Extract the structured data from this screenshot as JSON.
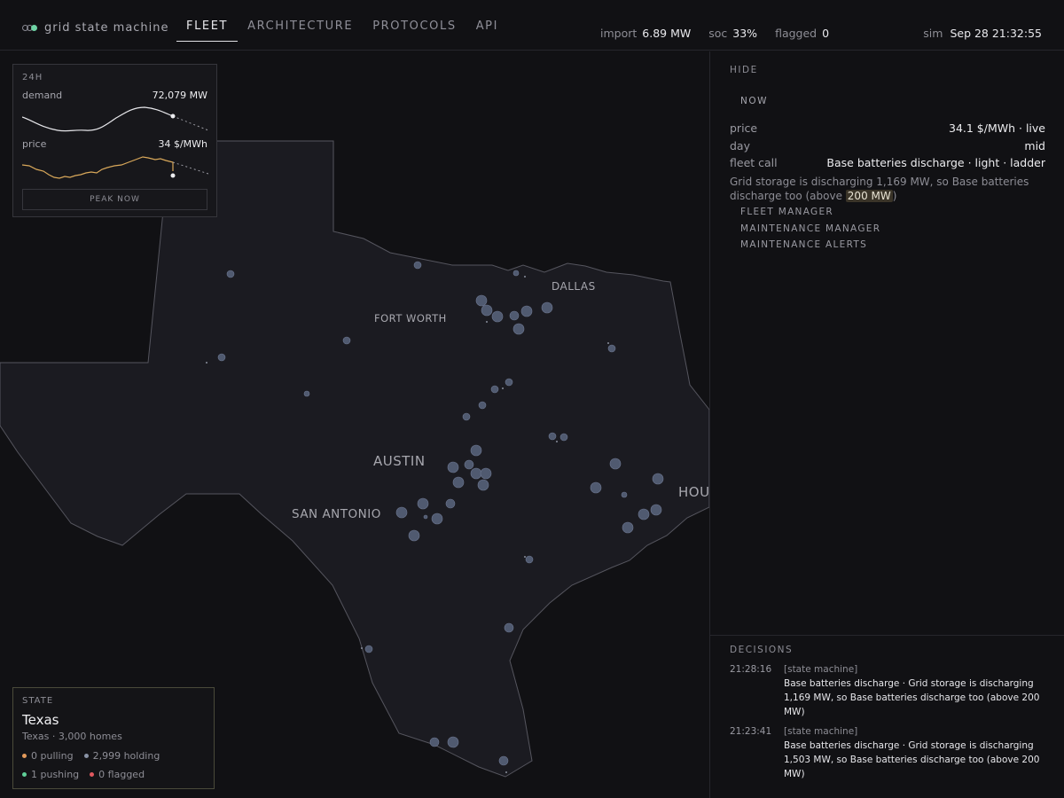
{
  "app": {
    "title": "grid state machine"
  },
  "nav": {
    "tabs": [
      {
        "label": "FLEET",
        "active": true
      },
      {
        "label": "ARCHITECTURE",
        "active": false
      },
      {
        "label": "PROTOCOLS",
        "active": false
      },
      {
        "label": "API",
        "active": false
      }
    ]
  },
  "stats": {
    "import": {
      "label": "import",
      "value": "6.89 MW"
    },
    "soc": {
      "label": "soc",
      "value": "33%"
    },
    "flagged": {
      "label": "flagged",
      "value": "0"
    }
  },
  "sim": {
    "label": "sim",
    "value": "Sep 28 21:32:55"
  },
  "map": {
    "cities": [
      "DALLAS",
      "FORT WORTH",
      "AUSTIN",
      "SAN ANTONIO",
      "HOU"
    ]
  },
  "mini_panel": {
    "header": "24H",
    "demand": {
      "label": "demand",
      "value": "72,079 MW"
    },
    "price": {
      "label": "price",
      "value": "34 $/MWh"
    },
    "button": "PEAK NOW",
    "colors": {
      "demand": "#e6e6ea",
      "price": "#d9a85a"
    }
  },
  "state_card": {
    "header": "STATE",
    "title": "Texas",
    "subtitle": "Texas · 3,000 homes",
    "counts": [
      {
        "label": "0 pulling",
        "color": "#e39a5b"
      },
      {
        "label": "2,999 holding",
        "color": "#8a93a6"
      },
      {
        "label": "1 pushing",
        "color": "#5fcf98"
      },
      {
        "label": "0 flagged",
        "color": "#e0585f"
      }
    ]
  },
  "panel": {
    "hide_label": "HIDE",
    "now_label": "NOW",
    "rows": [
      {
        "key": "price",
        "value": "34.1 $/MWh · live"
      },
      {
        "key": "day",
        "value": "mid"
      },
      {
        "key": "fleet call",
        "value": "Base batteries discharge · light · ladder"
      }
    ],
    "explanation": {
      "before": "Grid storage is discharging 1,169 MW, so Base batteries discharge too (above ",
      "highlight": "200 MW",
      "after": ")"
    },
    "links": [
      "FLEET MANAGER",
      "MAINTENANCE MANAGER",
      "MAINTENANCE ALERTS"
    ],
    "decisions_header": "DECISIONS",
    "decisions": [
      {
        "time": "21:28:16",
        "source": "[state machine]",
        "message": "Base batteries discharge · Grid storage is discharging 1,169 MW, so Base batteries discharge too (above 200 MW)"
      },
      {
        "time": "21:23:41",
        "source": "[state machine]",
        "message": "Base batteries discharge · Grid storage is discharging 1,503 MW, so Base batteries discharge too (above 200 MW)"
      }
    ]
  }
}
